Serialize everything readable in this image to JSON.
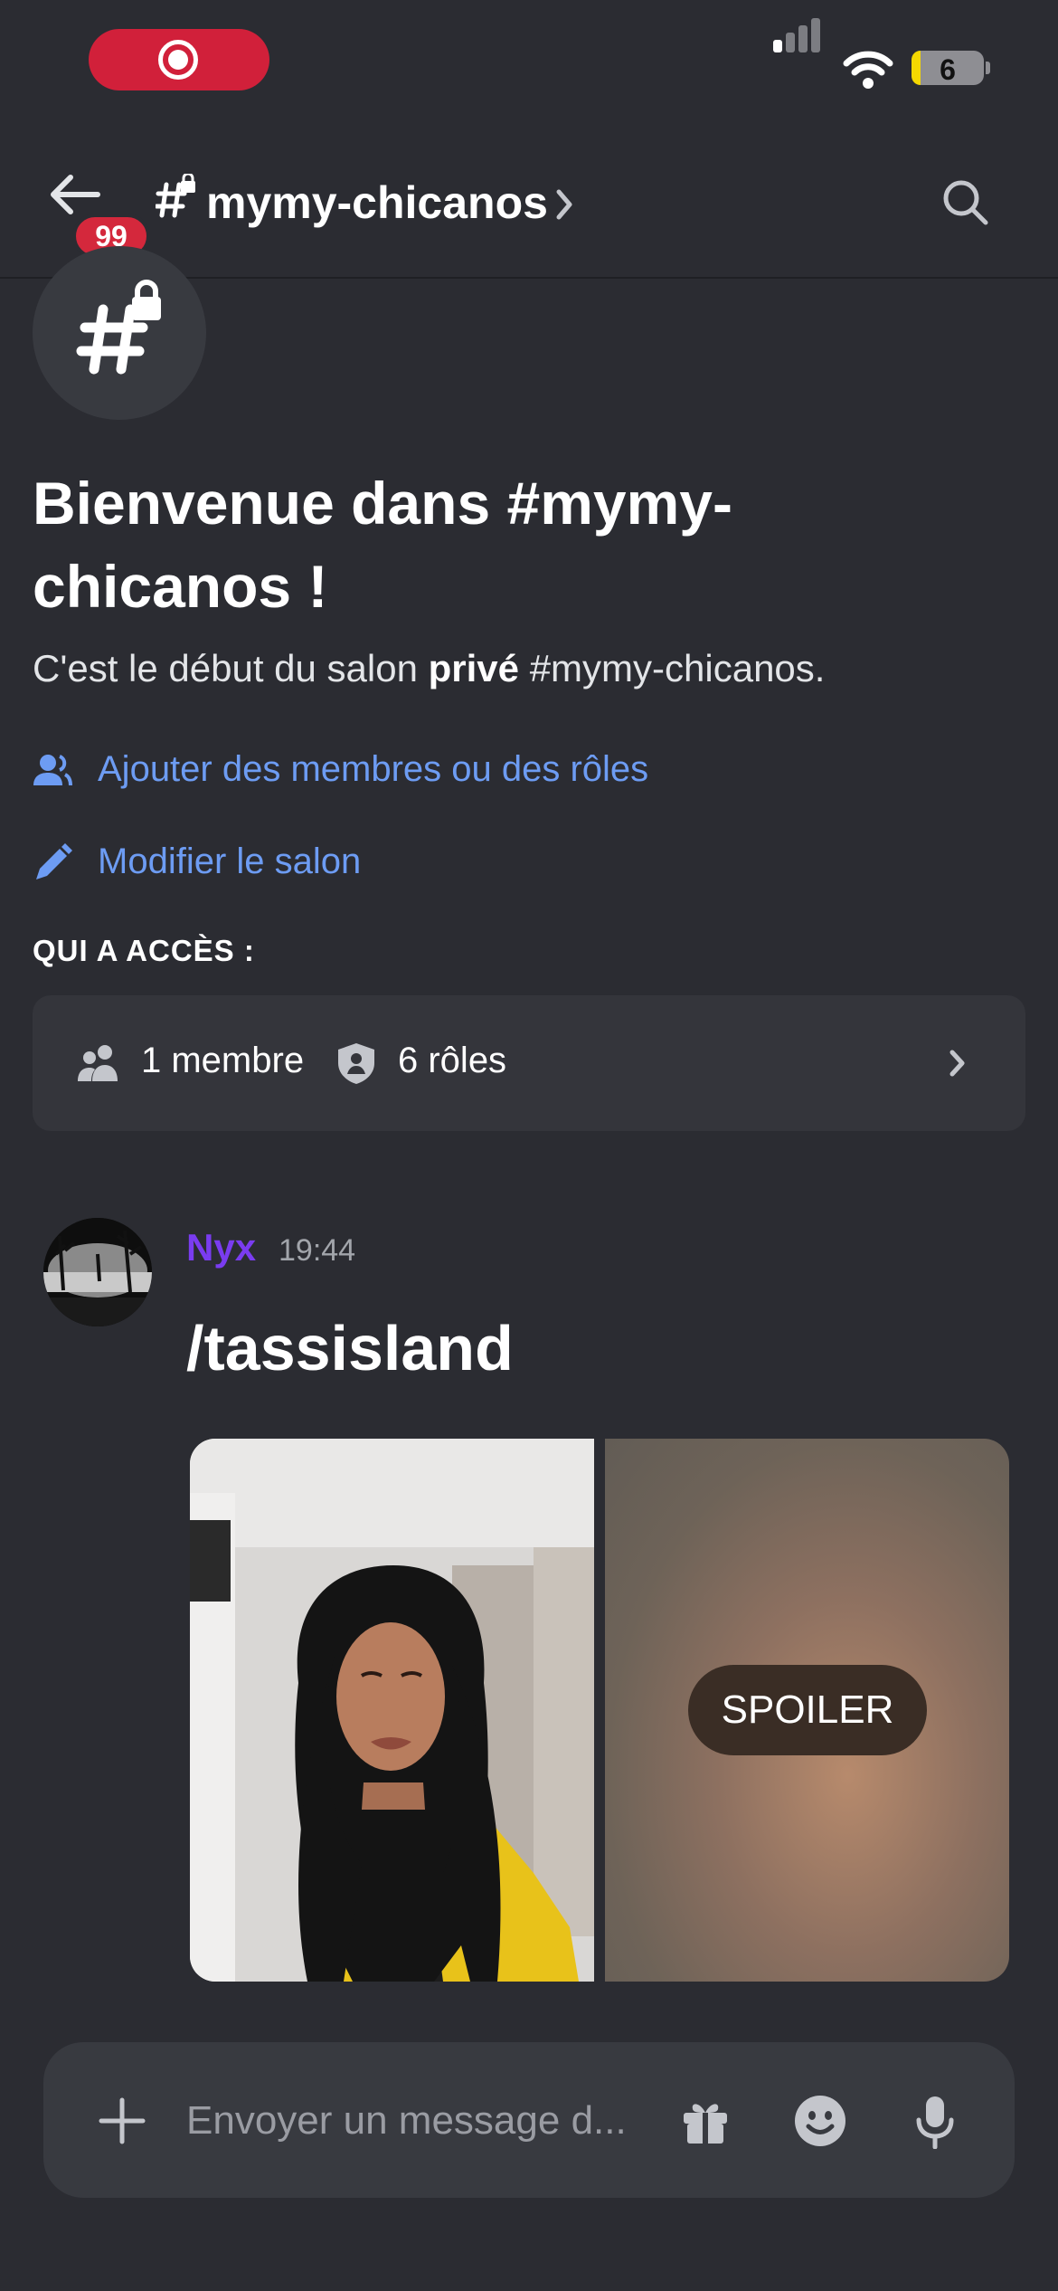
{
  "status_bar": {
    "battery_level": "6",
    "colors": {
      "recording": "#d1203a",
      "battery_fill": "#f5d800"
    }
  },
  "header": {
    "channel_name": "mymy-chicanos",
    "unread_badge": "99",
    "icons": [
      "back-arrow-icon",
      "locked-hash-icon",
      "chevron-right-icon",
      "search-icon"
    ]
  },
  "intro": {
    "title": "Bienvenue dans #mymy-chicanos !",
    "subtitle_prefix": "C'est le début du salon ",
    "subtitle_bold": "privé",
    "subtitle_suffix": " #mymy-chicanos.",
    "add_members_label": "Ajouter des membres ou des rôles",
    "edit_channel_label": "Modifier le salon",
    "access_heading": "QUI A ACCÈS :",
    "members_label": "1 membre",
    "roles_label": "6 rôles",
    "link_color": "#6d9cf3"
  },
  "message": {
    "author": "Nyx",
    "time": "19:44",
    "text": "/tassisland",
    "author_color": "#7a3cf0",
    "attachments": [
      {
        "type": "image",
        "spoiler": false
      },
      {
        "type": "image",
        "spoiler": true,
        "label": "SPOILER"
      }
    ]
  },
  "composer": {
    "placeholder": "Envoyer un message d...",
    "value": "",
    "icons": [
      "plus-icon",
      "gift-icon",
      "emoji-icon",
      "microphone-icon"
    ]
  }
}
